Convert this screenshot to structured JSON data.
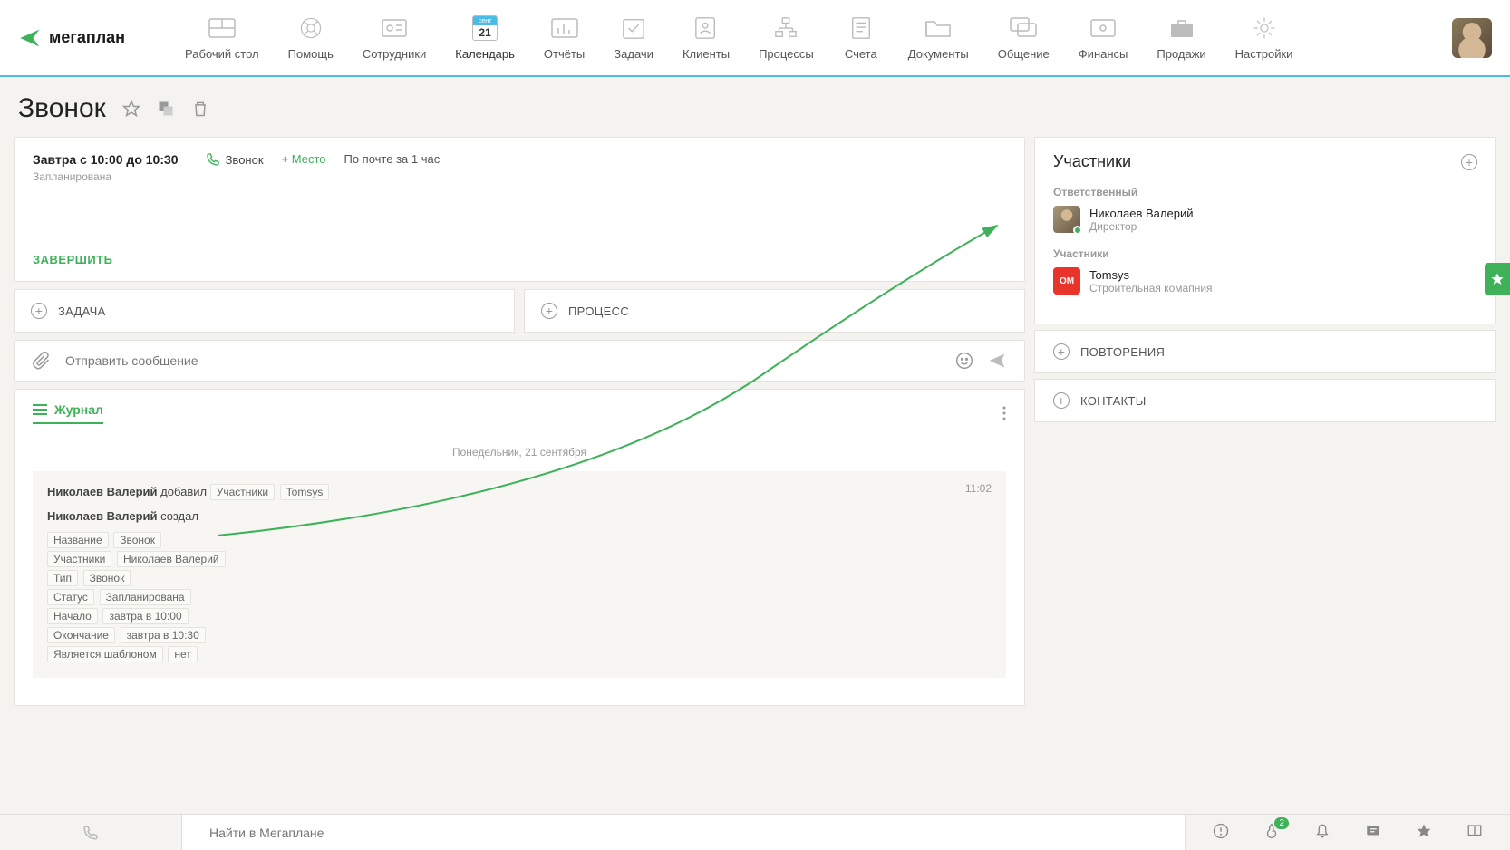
{
  "logo_text": "мегаплан",
  "nav": [
    {
      "label": "Рабочий стол"
    },
    {
      "label": "Помощь"
    },
    {
      "label": "Сотрудники"
    },
    {
      "label": "Календарь",
      "active": true,
      "month": "сент",
      "day": "21"
    },
    {
      "label": "Отчёты"
    },
    {
      "label": "Задачи"
    },
    {
      "label": "Клиенты"
    },
    {
      "label": "Процессы"
    },
    {
      "label": "Счета"
    },
    {
      "label": "Документы"
    },
    {
      "label": "Общение"
    },
    {
      "label": "Финансы"
    },
    {
      "label": "Продажи"
    },
    {
      "label": "Настройки"
    }
  ],
  "page_title": "Звонок",
  "info": {
    "time": "Завтра с 10:00 до 10:30",
    "status": "Запланирована",
    "type": "Звонок",
    "add_place": "+ Место",
    "remind": "По почте за 1 час",
    "complete": "ЗАВЕРШИТЬ"
  },
  "buttons": {
    "task": "ЗАДАЧА",
    "process": "ПРОЦЕСС"
  },
  "message_placeholder": "Отправить сообщение",
  "journal": {
    "tab": "Журнал",
    "date": "Понедельник, 21 сентября",
    "time": "11:02",
    "line1_author": "Николаев Валерий",
    "line1_action": "добавил",
    "line1_tag1": "Участники",
    "line1_tag2": "Tomsys",
    "line2_author": "Николаев Валерий",
    "line2_action": "создал",
    "fields": [
      {
        "k": "Название",
        "v": "Звонок"
      },
      {
        "k": "Участники",
        "v": "Николаев Валерий"
      },
      {
        "k": "Тип",
        "v": "Звонок"
      },
      {
        "k": "Статус",
        "v": "Запланирована"
      },
      {
        "k": "Начало",
        "v": "завтра в 10:00"
      },
      {
        "k": "Окончание",
        "v": "завтра в 10:30"
      },
      {
        "k": "Является шаблоном",
        "v": "нет"
      }
    ]
  },
  "sidebar": {
    "participants_title": "Участники",
    "responsible_label": "Ответственный",
    "responsible_name": "Николаев Валерий",
    "responsible_role": "Директор",
    "participants_label": "Участники",
    "company_name": "Tomsys",
    "company_desc": "Строительная комапния",
    "repeats": "ПОВТОРЕНИЯ",
    "contacts": "КОНТАКТЫ"
  },
  "bottombar": {
    "search_placeholder": "Найти в Мегаплане",
    "badge_count": "2"
  }
}
